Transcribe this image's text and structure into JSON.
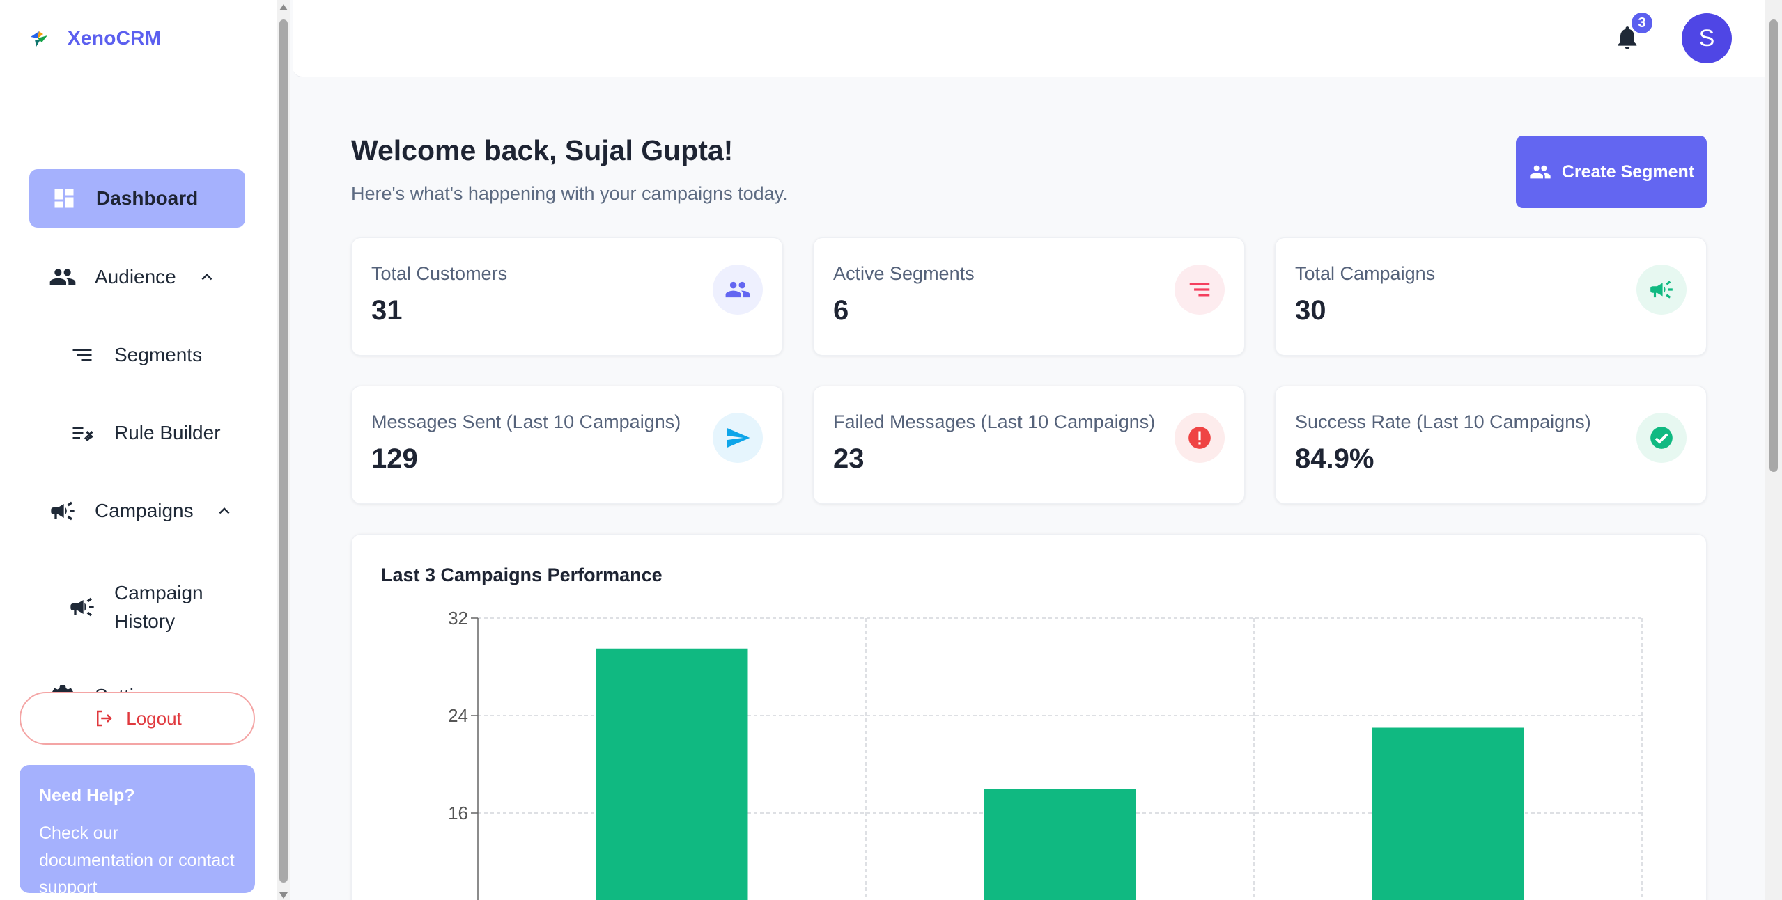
{
  "brand": {
    "name": "XenoCRM"
  },
  "sidebar": {
    "items": [
      {
        "label": "Dashboard",
        "icon": "dashboard-icon"
      },
      {
        "label": "Audience",
        "icon": "people-icon"
      },
      {
        "label": "Segments",
        "icon": "segments-icon"
      },
      {
        "label": "Rule Builder",
        "icon": "rule-builder-icon"
      },
      {
        "label": "Campaigns",
        "icon": "megaphone-icon"
      },
      {
        "label": "Campaign History",
        "icon": "megaphone-icon"
      },
      {
        "label": "Settings",
        "icon": "gear-icon"
      }
    ],
    "logout": "Logout",
    "help": {
      "title": "Need Help?",
      "text": "Check our documentation or contact support"
    }
  },
  "topbar": {
    "notifications": "3",
    "avatar_initial": "S"
  },
  "main": {
    "welcome": "Welcome back, Sujal Gupta!",
    "subtitle": "Here's what's happening with your campaigns today.",
    "create_button": "Create Segment"
  },
  "stats": [
    {
      "label": "Total Customers",
      "value": "31",
      "icon": "people-icon",
      "color": "#6366f1",
      "bg": "#eef0fe"
    },
    {
      "label": "Active Segments",
      "value": "6",
      "icon": "segments-icon",
      "color": "#f43f5e",
      "bg": "#fdecef"
    },
    {
      "label": "Total Campaigns",
      "value": "30",
      "icon": "megaphone-icon",
      "color": "#10b981",
      "bg": "#e7f8f1"
    },
    {
      "label": "Messages Sent (Last 10 Campaigns)",
      "value": "129",
      "icon": "send-icon",
      "color": "#0ea5e9",
      "bg": "#e6f5fd"
    },
    {
      "label": "Failed Messages (Last 10 Campaigns)",
      "value": "23",
      "icon": "alert-icon",
      "color": "#ef4444",
      "bg": "#fdecec"
    },
    {
      "label": "Success Rate (Last 10 Campaigns)",
      "value": "84.9%",
      "icon": "check-circle-icon",
      "color": "#10b981",
      "bg": "#e7f8f1"
    }
  ],
  "chart_title": "Last 3 Campaigns Performance",
  "chart_data": {
    "type": "bar",
    "title": "Last 3 Campaigns Performance",
    "categories": [
      "",
      "",
      ""
    ],
    "values": [
      29.5,
      18,
      23
    ],
    "yticks": [
      16,
      24,
      32
    ],
    "ylim": [
      0,
      32
    ],
    "grid": true,
    "color": "#10b981"
  }
}
